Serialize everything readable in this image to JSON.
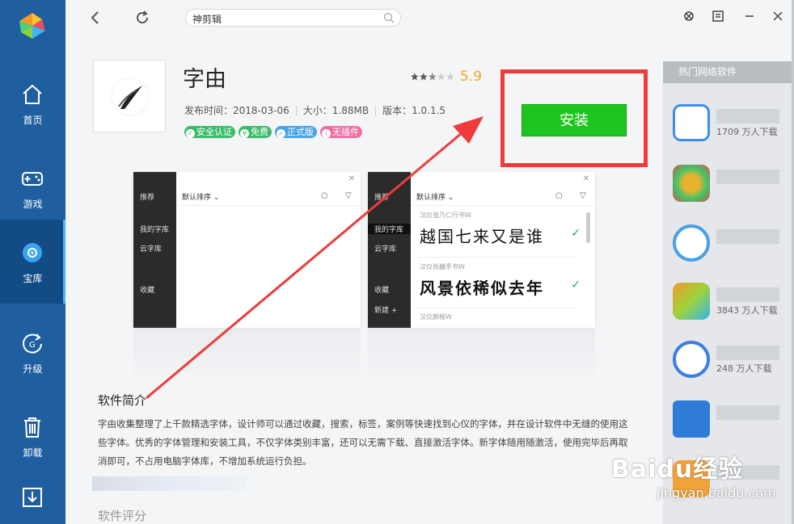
{
  "colors": {
    "sidebar": "#1f5fa0",
    "sidebar_active": "#134b84",
    "install_button": "#1ec51e",
    "highlight_box": "#ef3b3b",
    "rating": "#f5a623"
  },
  "sidebar": {
    "items": [
      {
        "label": "首页",
        "icon": "home-icon"
      },
      {
        "label": "游戏",
        "icon": "gamepad-icon"
      },
      {
        "label": "宝库",
        "icon": "disc-icon",
        "active": true
      },
      {
        "label": "升级",
        "icon": "upgrade-icon"
      },
      {
        "label": "卸载",
        "icon": "trash-icon"
      },
      {
        "label": "",
        "icon": "download-icon"
      }
    ]
  },
  "toolbar": {
    "search_value": "神剪辑"
  },
  "app": {
    "name": "字由",
    "rating": 2.5,
    "score": "5.9",
    "release": "发布时间：2018-03-06",
    "size": "大小：1.88MB",
    "version": "版本：1.0.1.5",
    "tags": [
      {
        "label": "安全认证",
        "color": "#3cbc6a"
      },
      {
        "label": "免费",
        "color": "#3cbc6a"
      },
      {
        "label": "正式版",
        "color": "#4aa3e6"
      },
      {
        "label": "无插件",
        "color": "#ee6fa5"
      }
    ],
    "install_label": "安装"
  },
  "screenshots": [
    {
      "menu": [
        "推荐",
        "我的字库",
        "云字库",
        "收藏"
      ],
      "sort_label": "默认排序"
    },
    {
      "menu": [
        "推荐",
        "我的字库",
        "云字库",
        "收藏",
        "新建 +"
      ],
      "sort_label": "默认排序",
      "fonts": [
        {
          "name": "汉仪张乃仁行书W",
          "sample": "越国七来又是谁"
        },
        {
          "name": "汉仪尚巍手书W",
          "sample": "风景依稀似去年"
        },
        {
          "name": "汉仪颜楷W",
          "sample": ""
        }
      ]
    }
  ],
  "description": {
    "title": "软件简介",
    "text": "字由收集整理了上千款精选字体，设计师可以通过收藏，搜索，标签，案例等快速找到心仪的字体，并在设计软件中无缝的使用这些字体。优秀的字体管理和安装工具，不仅字体类别丰富，还可以无需下载、直接激活字体。新字体随用随激活，使用完毕后再取消即可，不占用电脑字体库，不增加系统运行负担。"
  },
  "review": {
    "title": "软件评分"
  },
  "hot": {
    "title": "热门网络软件",
    "items": [
      {
        "downloads": "1709 万人下载",
        "color": "#3d8ee8"
      },
      {
        "downloads": "",
        "color": "#e8b22e"
      },
      {
        "downloads": "",
        "color": "#4aa0e6"
      },
      {
        "downloads": "3843 万人下载",
        "color": "#f09a2a"
      },
      {
        "downloads": "248 万人下载",
        "color": "#3b7fe0"
      },
      {
        "downloads": "",
        "color": "#2f7bd8"
      },
      {
        "downloads": "",
        "color": "#f2a23a"
      }
    ]
  },
  "watermark": {
    "brand": "Baidu经验",
    "url": "jingyan.baidu.com"
  }
}
